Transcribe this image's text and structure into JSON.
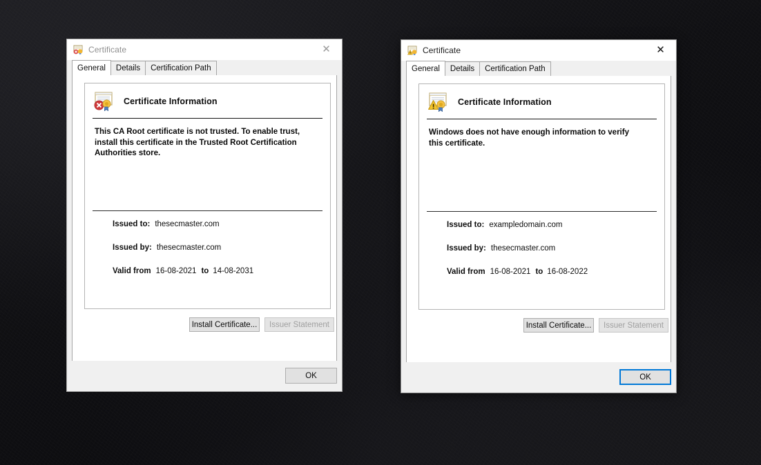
{
  "desktop": {
    "background_color": "#131316"
  },
  "dialogs": [
    {
      "id": "left",
      "state": "inactive",
      "title": "Certificate",
      "title_icon": "certificate-error-icon",
      "close_icon": "close-icon",
      "tabs": [
        {
          "label": "General",
          "selected": true
        },
        {
          "label": "Details",
          "selected": false
        },
        {
          "label": "Certification Path",
          "selected": false
        }
      ],
      "info": {
        "icon": "certificate-error-icon",
        "heading": "Certificate Information",
        "message": "This CA Root certificate is not trusted. To enable trust,\ninstall this certificate in the Trusted Root Certification\nAuthorities store.",
        "fields": {
          "issued_to_label": "Issued to:",
          "issued_to_value": "thesecmaster.com",
          "issued_by_label": "Issued by:",
          "issued_by_value": "thesecmaster.com",
          "valid_from_label": "Valid from",
          "valid_from_value": "16-08-2021",
          "valid_to_separator": "to",
          "valid_to_value": "14-08-2031"
        }
      },
      "buttons": {
        "install": {
          "label": "Install Certificate...",
          "disabled": false
        },
        "issuer": {
          "label": "Issuer Statement",
          "disabled": true
        },
        "ok": {
          "label": "OK",
          "focused": false
        }
      }
    },
    {
      "id": "right",
      "state": "active",
      "title": "Certificate",
      "title_icon": "certificate-warning-icon",
      "close_icon": "close-icon",
      "tabs": [
        {
          "label": "General",
          "selected": true
        },
        {
          "label": "Details",
          "selected": false
        },
        {
          "label": "Certification Path",
          "selected": false
        }
      ],
      "info": {
        "icon": "certificate-warning-icon",
        "heading": "Certificate Information",
        "message": "Windows does not have enough information to verify\nthis certificate.",
        "fields": {
          "issued_to_label": "Issued to:",
          "issued_to_value": "exampledomain.com",
          "issued_by_label": "Issued by:",
          "issued_by_value": "thesecmaster.com",
          "valid_from_label": "Valid from",
          "valid_from_value": "16-08-2021",
          "valid_to_separator": "to",
          "valid_to_value": "16-08-2022"
        }
      },
      "buttons": {
        "install": {
          "label": "Install Certificate...",
          "disabled": false
        },
        "issuer": {
          "label": "Issuer Statement",
          "disabled": true
        },
        "ok": {
          "label": "OK",
          "focused": true
        }
      }
    }
  ],
  "colors": {
    "focus_blue": "#0078d7",
    "error_red": "#d13438",
    "warning_yellow": "#ffc20e",
    "dialog_face": "#f0f0f0"
  }
}
